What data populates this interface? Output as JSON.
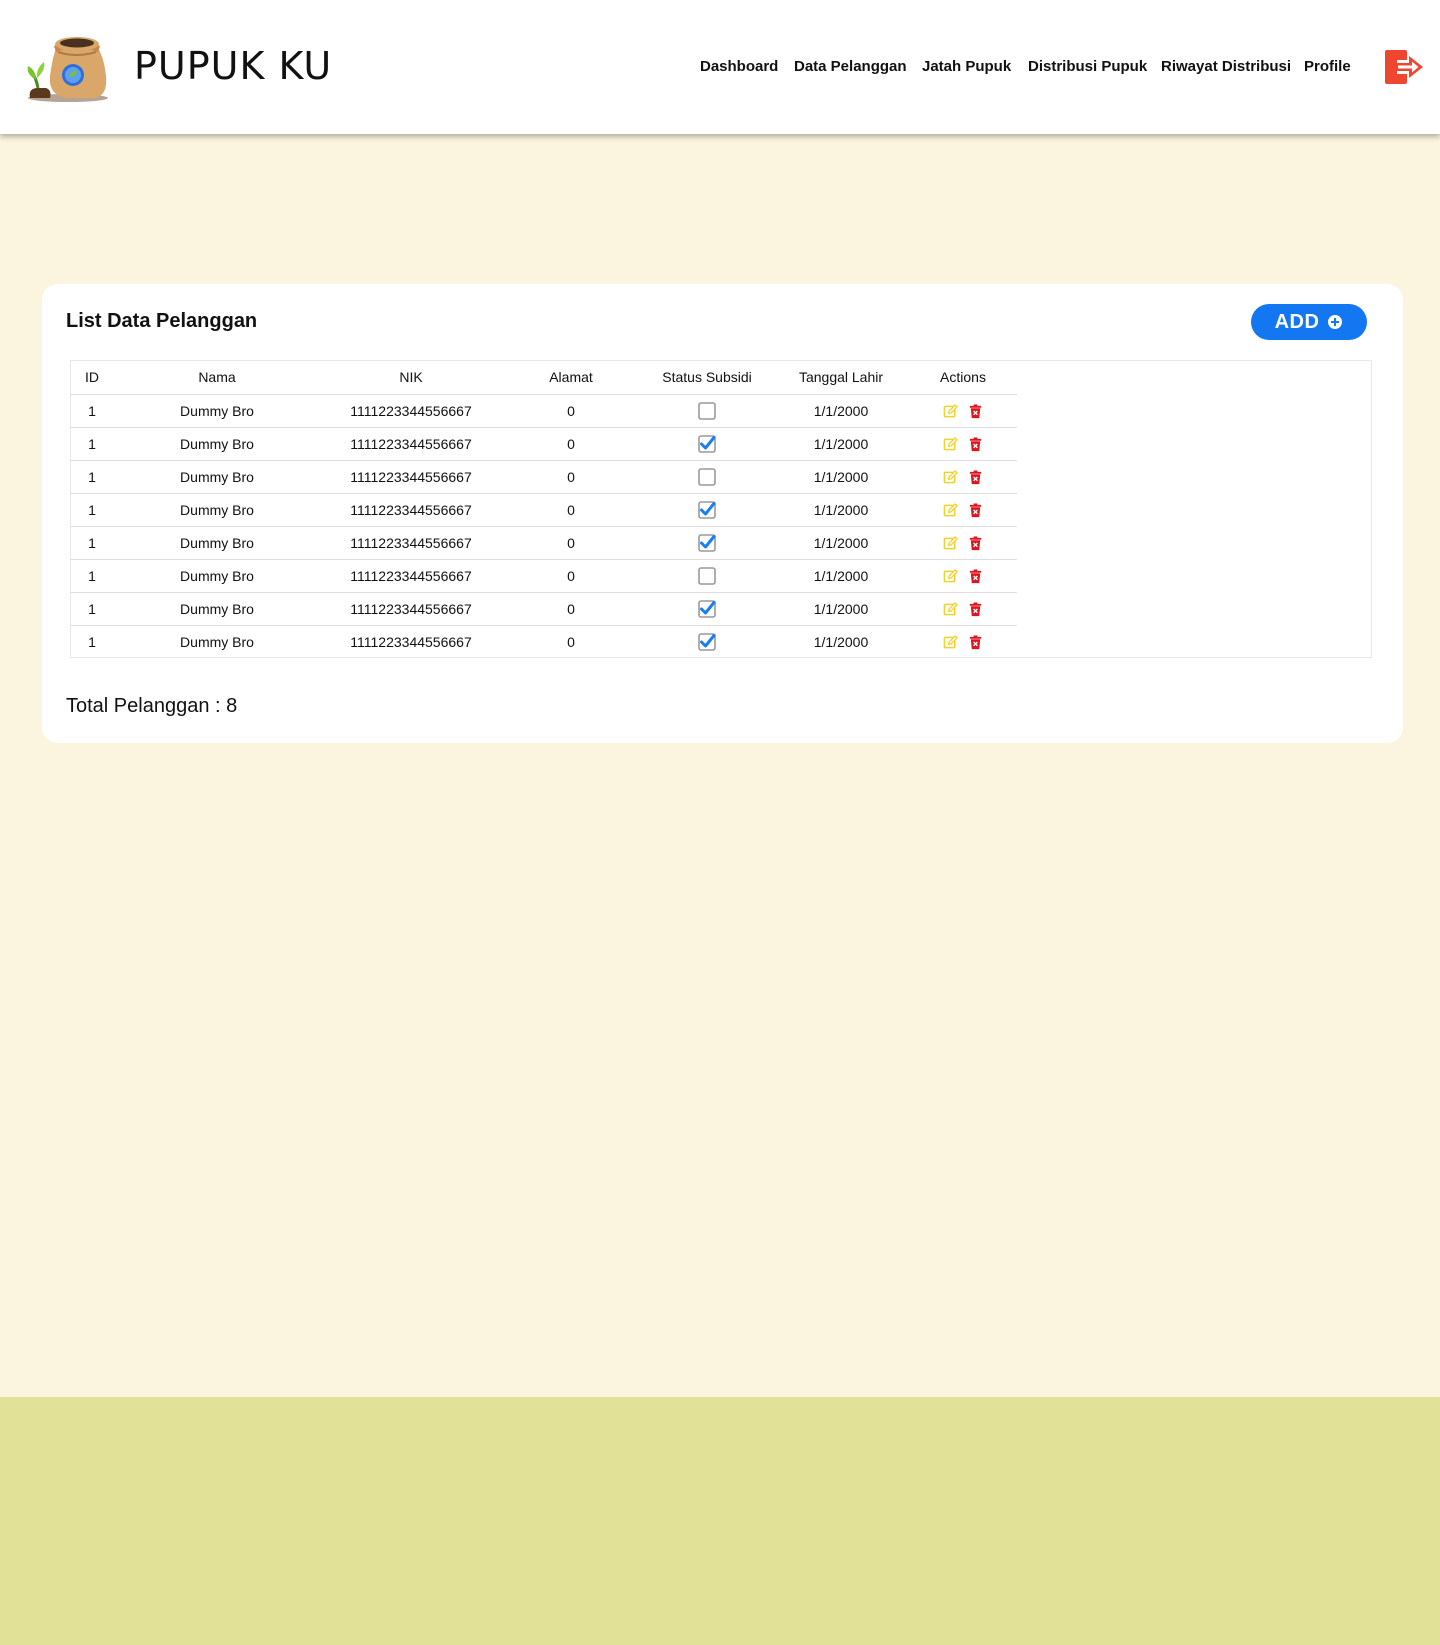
{
  "brand": {
    "name": "PUPUK KU"
  },
  "nav": {
    "items": [
      {
        "label": "Dashboard"
      },
      {
        "label": "Data Pelanggan"
      },
      {
        "label": "Jatah Pupuk"
      },
      {
        "label": "Distribusi Pupuk"
      },
      {
        "label": "Riwayat Distribusi"
      },
      {
        "label": "Profile"
      }
    ],
    "logout_icon": "logout-icon"
  },
  "main": {
    "title": "List Data Pelanggan",
    "add_label": "ADD",
    "add_icon": "plus-circle-icon",
    "table": {
      "columns": [
        "ID",
        "Nama",
        "NIK",
        "Alamat",
        "Status Subsidi",
        "Tanggal Lahir",
        "Actions"
      ],
      "rows": [
        {
          "id": "1",
          "nama": "Dummy Bro",
          "nik": "1111223344556667",
          "alamat": "0",
          "subsidi": false,
          "tanggal": "1/1/2000"
        },
        {
          "id": "1",
          "nama": "Dummy Bro",
          "nik": "1111223344556667",
          "alamat": "0",
          "subsidi": true,
          "tanggal": "1/1/2000"
        },
        {
          "id": "1",
          "nama": "Dummy Bro",
          "nik": "1111223344556667",
          "alamat": "0",
          "subsidi": false,
          "tanggal": "1/1/2000"
        },
        {
          "id": "1",
          "nama": "Dummy Bro",
          "nik": "1111223344556667",
          "alamat": "0",
          "subsidi": true,
          "tanggal": "1/1/2000"
        },
        {
          "id": "1",
          "nama": "Dummy Bro",
          "nik": "1111223344556667",
          "alamat": "0",
          "subsidi": true,
          "tanggal": "1/1/2000"
        },
        {
          "id": "1",
          "nama": "Dummy Bro",
          "nik": "1111223344556667",
          "alamat": "0",
          "subsidi": false,
          "tanggal": "1/1/2000"
        },
        {
          "id": "1",
          "nama": "Dummy Bro",
          "nik": "1111223344556667",
          "alamat": "0",
          "subsidi": true,
          "tanggal": "1/1/2000"
        },
        {
          "id": "1",
          "nama": "Dummy Bro",
          "nik": "1111223344556667",
          "alamat": "0",
          "subsidi": true,
          "tanggal": "1/1/2000"
        }
      ],
      "action_icons": [
        "edit-icon",
        "delete-icon"
      ]
    },
    "total_label": "Total Pelanggan : 8"
  },
  "colors": {
    "page_bg": "#fbf4df",
    "footer_bg": "#e1e297",
    "accent_blue": "#1277f0",
    "logout_red": "#f0452f",
    "edit_yellow": "#f2d12e",
    "delete_red": "#e0141e"
  }
}
